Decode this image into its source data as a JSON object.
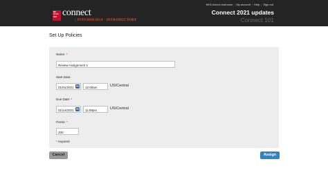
{
  "header": {
    "logo_text": "Mc Graw Hill",
    "brand": "connect",
    "course": "| PSYCHOLOGY - INTRODUCTORY",
    "links": [
      "MHConnect Instructor",
      "My account",
      "Help",
      "Sign out"
    ],
    "title": "Connect 2021 updates",
    "subtitle": "Connect 101"
  },
  "page": {
    "title": "Set Up Policies"
  },
  "form": {
    "name_label": "Name:",
    "name_value": "Review Assignment 1",
    "start_label": "Start Date:",
    "start_date": "01/01/2021",
    "start_time": "12:00am",
    "start_tz": "US/Central",
    "due_label": "Due Date:",
    "due_date": "01/14/2021",
    "due_time": "11:59pm",
    "due_tz": "US/Central",
    "points_label": "Points:",
    "points_value": "200",
    "required_star": "*",
    "required_note": "required"
  },
  "buttons": {
    "cancel": "Cancel",
    "assign": "Assign"
  },
  "colors": {
    "header_bg": "#242424",
    "accent": "#c8102e",
    "assign": "#2f84c6"
  }
}
